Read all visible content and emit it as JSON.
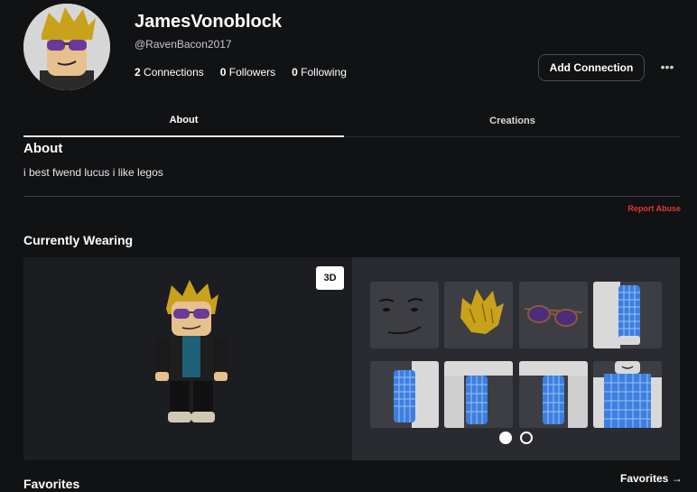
{
  "profile": {
    "display_name": "JamesVonoblock",
    "username": "@RavenBacon2017",
    "connections": {
      "count": "2",
      "label": "Connections"
    },
    "followers": {
      "count": "0",
      "label": "Followers"
    },
    "following": {
      "count": "0",
      "label": "Following"
    },
    "add_connection_label": "Add Connection",
    "more_icon": "more-horizontal-icon"
  },
  "tabs": [
    {
      "label": "About",
      "active": true
    },
    {
      "label": "Creations",
      "active": false
    }
  ],
  "about": {
    "title": "About",
    "text": "i best fwend lucus i like legos",
    "report_label": "Report Abuse"
  },
  "wearing": {
    "title": "Currently Wearing",
    "view_toggle_label": "3D",
    "items": [
      {
        "name": "face"
      },
      {
        "name": "hair"
      },
      {
        "name": "sunglasses"
      },
      {
        "name": "left-arm-blue-check"
      },
      {
        "name": "right-arm-blue-check"
      },
      {
        "name": "left-leg-blue-check"
      },
      {
        "name": "right-leg-blue-check"
      },
      {
        "name": "torso-blue-check"
      }
    ],
    "pagination": {
      "pages": 2,
      "current": 1
    }
  },
  "favorites": {
    "title": "Favorites",
    "link_label": "Favorites →"
  },
  "colors": {
    "background": "#111214",
    "report": "#e2392f",
    "blue_check": "#3d7fe0"
  }
}
